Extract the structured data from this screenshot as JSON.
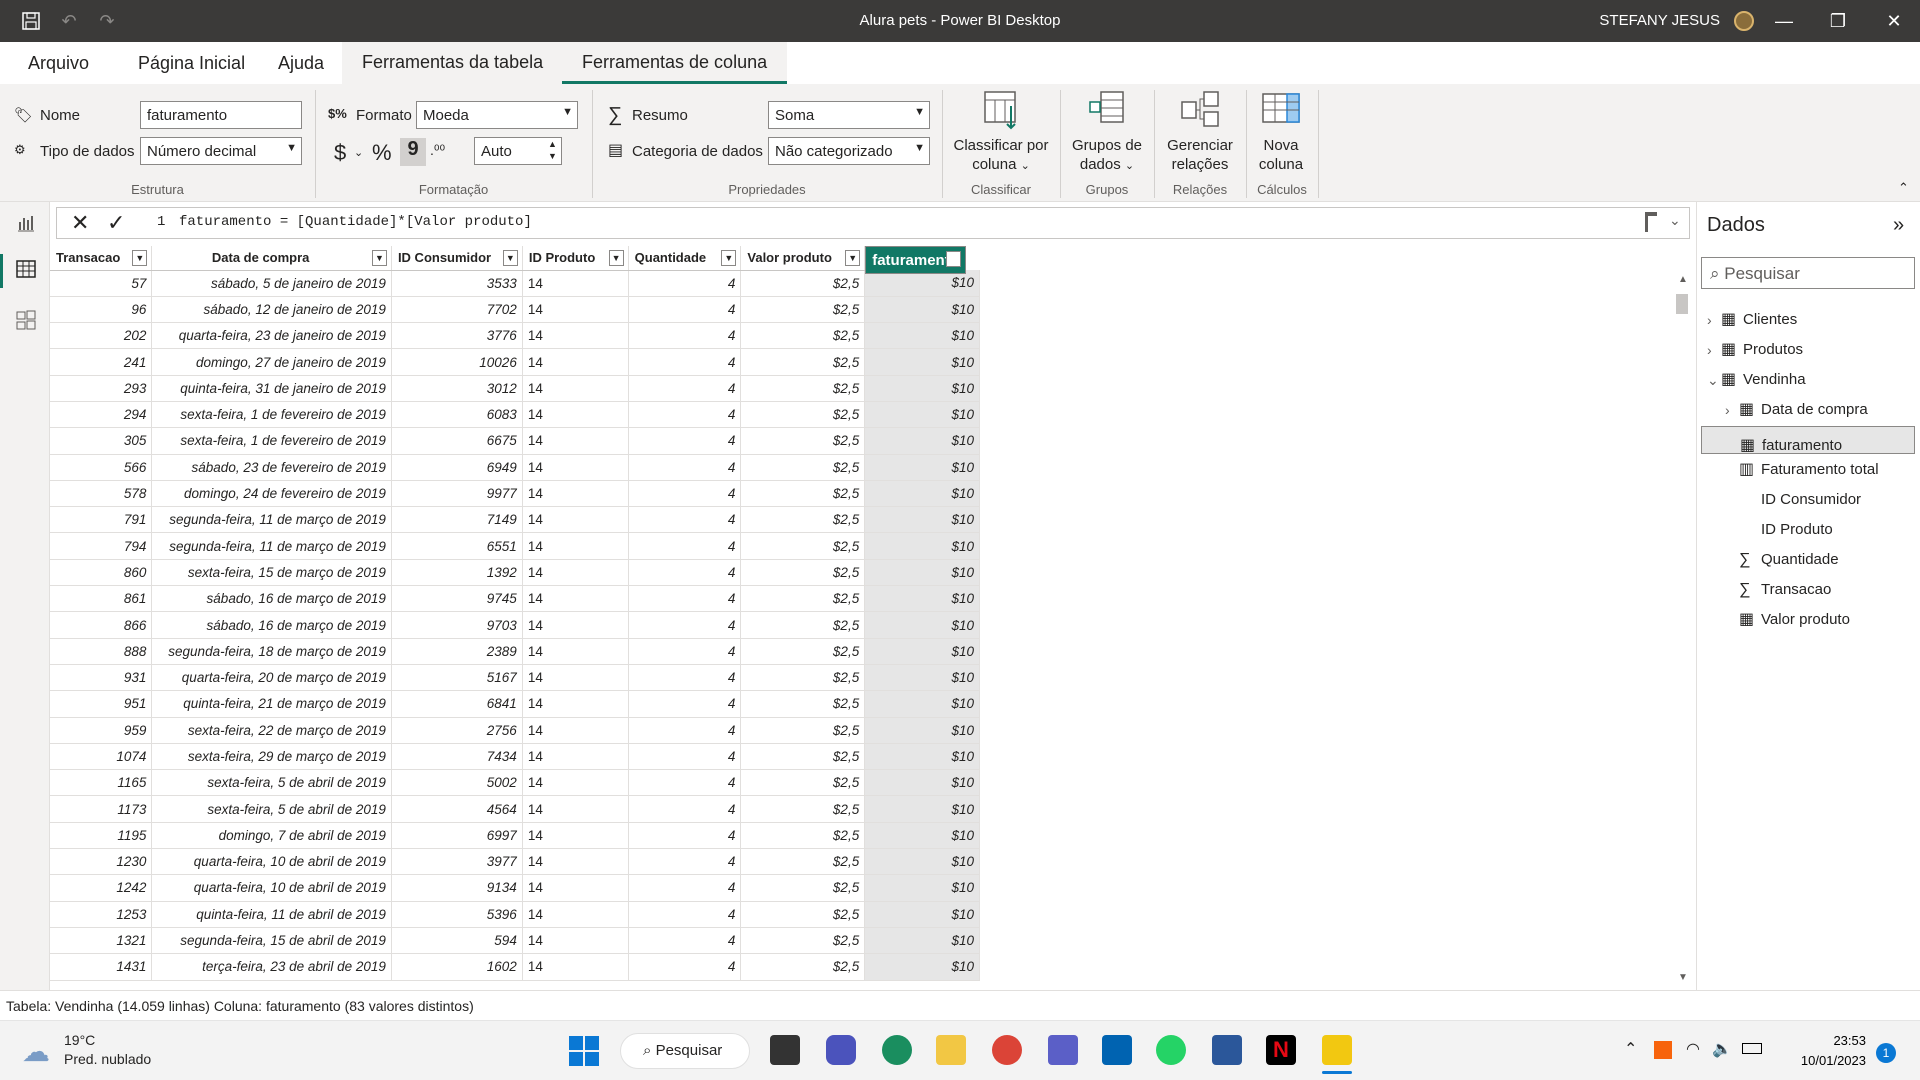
{
  "window": {
    "title": "Alura pets - Power BI Desktop",
    "user": "STEFANY JESUS",
    "minimize": "—",
    "restore": "❐",
    "close": "✕"
  },
  "menu": {
    "tabs": [
      "Arquivo",
      "Página Inicial",
      "Ajuda",
      "Ferramentas da tabela",
      "Ferramentas de coluna"
    ]
  },
  "ribbon": {
    "nome_label": "Nome",
    "nome_value": "faturamento",
    "tipo_label": "Tipo de dados",
    "tipo_value": "Número decimal",
    "estrutura": "Estrutura",
    "formato_label": "Formato",
    "formato_value": "Moeda",
    "currency": "$",
    "percent": "%",
    "comma": "9",
    "decimals_value": "Auto",
    "formatacao": "Formatação",
    "resumo_label": "Resumo",
    "resumo_value": "Soma",
    "categoria_label": "Categoria de dados",
    "categoria_value": "Não categorizado",
    "propriedades": "Propriedades",
    "classificar_l1": "Classificar por",
    "classificar_l2": "coluna",
    "classificar_group": "Classificar",
    "grupos_l1": "Grupos de",
    "grupos_l2": "dados",
    "grupos_group": "Grupos",
    "gerenciar_l1": "Gerenciar",
    "gerenciar_l2": "relações",
    "relacoes_group": "Relações",
    "nova_l1": "Nova",
    "nova_l2": "coluna",
    "calculos_group": "Cálculos"
  },
  "formula": {
    "line": "1",
    "text": "faturamento = [Quantidade]*[Valor produto]"
  },
  "table": {
    "headers": [
      "Transacao",
      "Data de compra",
      "ID Consumidor",
      "ID Produto",
      "Quantidade",
      "Valor produto",
      "faturamento"
    ],
    "rows": [
      [
        "57",
        "sábado, 5 de janeiro de 2019",
        "3533",
        "14",
        "4",
        "$2,5",
        "$10"
      ],
      [
        "96",
        "sábado, 12 de janeiro de 2019",
        "7702",
        "14",
        "4",
        "$2,5",
        "$10"
      ],
      [
        "202",
        "quarta-feira, 23 de janeiro de 2019",
        "3776",
        "14",
        "4",
        "$2,5",
        "$10"
      ],
      [
        "241",
        "domingo, 27 de janeiro de 2019",
        "10026",
        "14",
        "4",
        "$2,5",
        "$10"
      ],
      [
        "293",
        "quinta-feira, 31 de janeiro de 2019",
        "3012",
        "14",
        "4",
        "$2,5",
        "$10"
      ],
      [
        "294",
        "sexta-feira, 1 de fevereiro de 2019",
        "6083",
        "14",
        "4",
        "$2,5",
        "$10"
      ],
      [
        "305",
        "sexta-feira, 1 de fevereiro de 2019",
        "6675",
        "14",
        "4",
        "$2,5",
        "$10"
      ],
      [
        "566",
        "sábado, 23 de fevereiro de 2019",
        "6949",
        "14",
        "4",
        "$2,5",
        "$10"
      ],
      [
        "578",
        "domingo, 24 de fevereiro de 2019",
        "9977",
        "14",
        "4",
        "$2,5",
        "$10"
      ],
      [
        "791",
        "segunda-feira, 11 de março de 2019",
        "7149",
        "14",
        "4",
        "$2,5",
        "$10"
      ],
      [
        "794",
        "segunda-feira, 11 de março de 2019",
        "6551",
        "14",
        "4",
        "$2,5",
        "$10"
      ],
      [
        "860",
        "sexta-feira, 15 de março de 2019",
        "1392",
        "14",
        "4",
        "$2,5",
        "$10"
      ],
      [
        "861",
        "sábado, 16 de março de 2019",
        "9745",
        "14",
        "4",
        "$2,5",
        "$10"
      ],
      [
        "866",
        "sábado, 16 de março de 2019",
        "9703",
        "14",
        "4",
        "$2,5",
        "$10"
      ],
      [
        "888",
        "segunda-feira, 18 de março de 2019",
        "2389",
        "14",
        "4",
        "$2,5",
        "$10"
      ],
      [
        "931",
        "quarta-feira, 20 de março de 2019",
        "5167",
        "14",
        "4",
        "$2,5",
        "$10"
      ],
      [
        "951",
        "quinta-feira, 21 de março de 2019",
        "6841",
        "14",
        "4",
        "$2,5",
        "$10"
      ],
      [
        "959",
        "sexta-feira, 22 de março de 2019",
        "2756",
        "14",
        "4",
        "$2,5",
        "$10"
      ],
      [
        "1074",
        "sexta-feira, 29 de março de 2019",
        "7434",
        "14",
        "4",
        "$2,5",
        "$10"
      ],
      [
        "1165",
        "sexta-feira, 5 de abril de 2019",
        "5002",
        "14",
        "4",
        "$2,5",
        "$10"
      ],
      [
        "1173",
        "sexta-feira, 5 de abril de 2019",
        "4564",
        "14",
        "4",
        "$2,5",
        "$10"
      ],
      [
        "1195",
        "domingo, 7 de abril de 2019",
        "6997",
        "14",
        "4",
        "$2,5",
        "$10"
      ],
      [
        "1230",
        "quarta-feira, 10 de abril de 2019",
        "3977",
        "14",
        "4",
        "$2,5",
        "$10"
      ],
      [
        "1242",
        "quarta-feira, 10 de abril de 2019",
        "9134",
        "14",
        "4",
        "$2,5",
        "$10"
      ],
      [
        "1253",
        "quinta-feira, 11 de abril de 2019",
        "5396",
        "14",
        "4",
        "$2,5",
        "$10"
      ],
      [
        "1321",
        "segunda-feira, 15 de abril de 2019",
        "594",
        "14",
        "4",
        "$2,5",
        "$10"
      ],
      [
        "1431",
        "terça-feira, 23 de abril de 2019",
        "1602",
        "14",
        "4",
        "$2,5",
        "$10"
      ]
    ]
  },
  "dados": {
    "title": "Dados",
    "search_placeholder": "Pesquisar",
    "items": [
      {
        "label": "Clientes",
        "icon": "table-icon",
        "expander": "›"
      },
      {
        "label": "Produtos",
        "icon": "table-icon",
        "expander": "›"
      },
      {
        "label": "Vendinha",
        "icon": "table-icon",
        "expander": "⌄"
      },
      {
        "label": "Data de compra",
        "icon": "calendar-icon",
        "expander": "›"
      },
      {
        "label": "faturamento",
        "icon": "calculated-column-icon",
        "expander": ""
      },
      {
        "label": "Faturamento total",
        "icon": "measure-icon",
        "expander": ""
      },
      {
        "label": "ID Consumidor",
        "icon": "",
        "expander": ""
      },
      {
        "label": "ID Produto",
        "icon": "",
        "expander": ""
      },
      {
        "label": "Quantidade",
        "icon": "sigma-icon",
        "expander": ""
      },
      {
        "label": "Transacao",
        "icon": "sigma-icon",
        "expander": ""
      },
      {
        "label": "Valor produto",
        "icon": "calculated-column-icon",
        "expander": ""
      }
    ]
  },
  "status": {
    "text": "Tabela: Vendinha (14.059 linhas) Coluna: faturamento (83 valores distintos)"
  },
  "taskbar": {
    "temp": "19°C",
    "weather": "Pred. nublado",
    "search": "Pesquisar",
    "time": "23:53",
    "date": "10/01/2023",
    "badge": "1"
  }
}
